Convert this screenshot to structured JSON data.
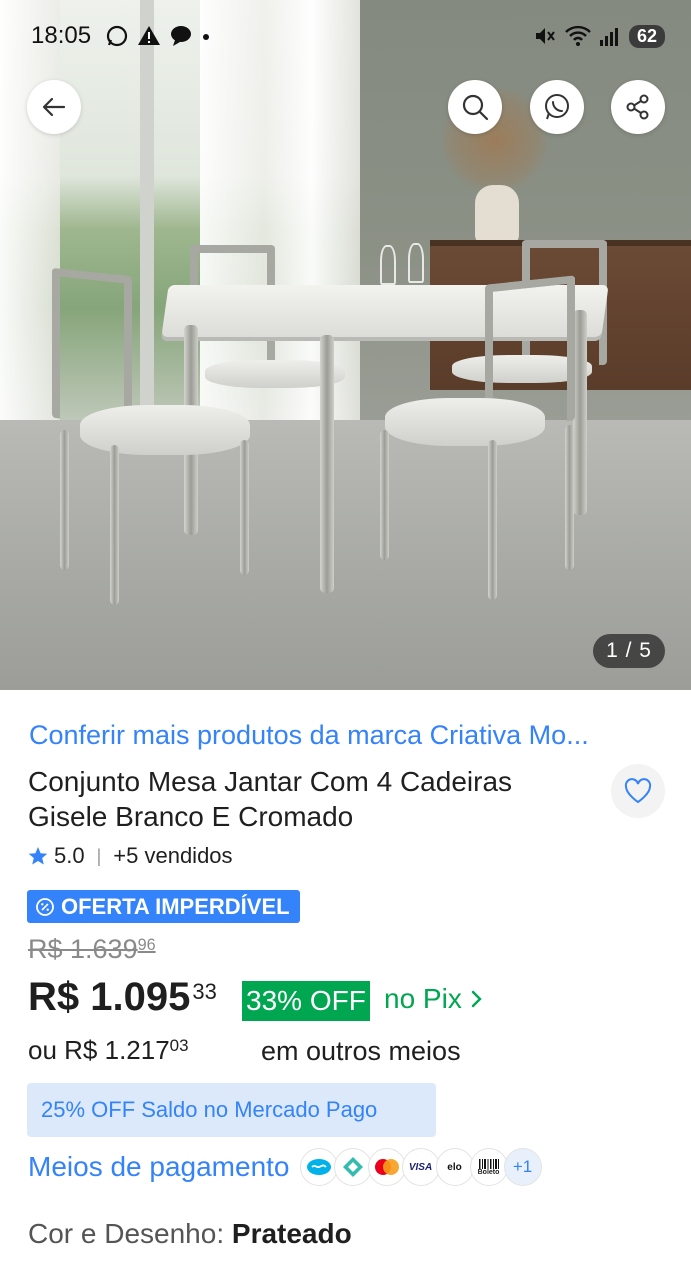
{
  "status_bar": {
    "time": "18:05",
    "battery": "62"
  },
  "gallery": {
    "counter": "1 / 5"
  },
  "product": {
    "brand_link": "Conferir mais produtos da marca Criativa Mo...",
    "title": "Conjunto Mesa Jantar Com 4 Cadeiras Gisele Branco E Cromado",
    "rating": "5.0",
    "sold": "+5 vendidos",
    "offer_badge": "OFERTA IMPERDÍVEL",
    "old_price_main": "R$ 1.639",
    "old_price_cents": "96",
    "price_main": "R$ 1.095",
    "price_cents": "33",
    "discount": "33% OFF",
    "pix_label": "no Pix",
    "alt_price_main": "ou R$ 1.217",
    "alt_price_cents": "03",
    "alt_price_label": "em outros meios",
    "mercado_pago_offer": "25% OFF Saldo no Mercado Pago",
    "payment_methods_label": "Meios de pagamento",
    "payment_methods": [
      "mercado-pago-icon",
      "pix-icon",
      "mastercard-icon",
      "VISA",
      "elo",
      "Boleto"
    ],
    "payment_more": "+1",
    "color_label": "Cor e Desenho:",
    "color_value": "Prateado"
  },
  "colors": {
    "link_blue": "#3483fa",
    "green": "#00a650",
    "light_blue_bg": "#dbe9fb"
  }
}
